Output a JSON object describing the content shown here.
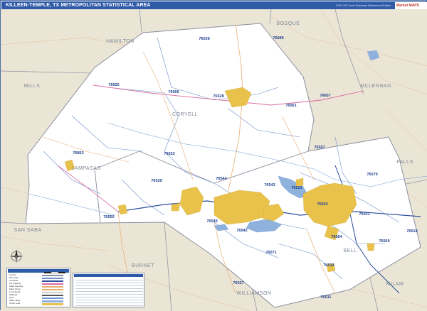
{
  "map": {
    "title": "KILLEEN-TEMPLE, TX METROPOLITAN STATISTICAL AREA",
    "edition": "2020 ZIP Code Business Reference Edition",
    "publisher_logo": "Market MAPS",
    "counties": {
      "hamilton": "HAMILTON",
      "bosque": "BOSQUE",
      "mills": "MILLS",
      "mclennan": "MCLENNAN",
      "coryell": "CORYELL",
      "falls": "FALLS",
      "lampasas": "LAMPASAS",
      "san_saba": "SAN SABA",
      "bell": "BELL",
      "burnet": "BURNET",
      "milam": "MILAM",
      "williamson": "WILLIAMSON"
    },
    "zip_codes": {
      "z76538": "76538",
      "z76689": "76689",
      "z76525": "76525",
      "z76566": "76566",
      "z76528": "76528",
      "z76657": "76657",
      "z76561": "76561",
      "z76557": "76557",
      "z76853": "76853",
      "z76522": "76522",
      "z76579": "76579",
      "z76544": "76544",
      "z76539": "76539",
      "z76543": "76543",
      "z76513": "76513",
      "z76502": "76502",
      "z76501": "76501",
      "z76550": "76550",
      "z76549": "76549",
      "z76542": "76542",
      "z76554": "76554",
      "z76519": "76519",
      "z76569": "76569",
      "z76571": "76571",
      "z76534": "76534",
      "z76527": "76527",
      "z76511": "76511"
    }
  },
  "colors": {
    "title_bar": "#2e5aa8",
    "outside_area": "#ebe5d6",
    "metro_area": "#ffffff",
    "urban_area": "#e8c24a",
    "water": "#8fb2dd",
    "county_border": "#8a8fa0",
    "zip_border": "#6a8fc9",
    "interstate": "#2c4e9e",
    "highway": "#d96ba2",
    "road": "#e6ad73"
  },
  "legend": {
    "title": "Killeen-Temple Legend",
    "rows": [
      "County",
      "ZIP Code",
      "Interstate",
      "US Highway",
      "State Highway",
      "Major Road",
      "Local Road",
      "Railroad",
      "River",
      "Water Body",
      "Urban Area"
    ]
  },
  "reference_table": {
    "title": "ZIP Code Business Reference"
  },
  "compass_icon": "north-arrow-icon",
  "scale_bar": "scale-bar-icon"
}
